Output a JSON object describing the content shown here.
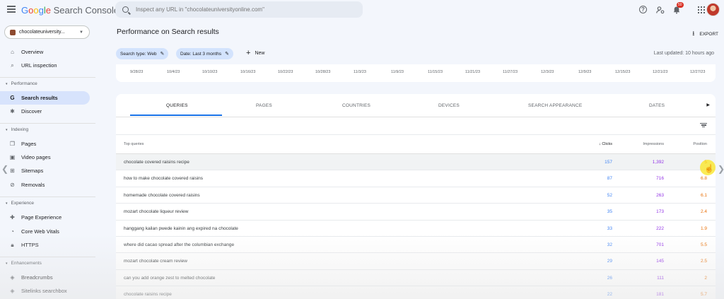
{
  "header": {
    "logo_google": "Google",
    "logo_product": "Search Console",
    "search_placeholder": "Inspect any URL in \"chocolateuniversityonline.com\"",
    "notification_count": "50"
  },
  "sidebar": {
    "property": "chocolateuniversity...",
    "items": [
      {
        "label": "Overview",
        "icon": "home-icon"
      },
      {
        "label": "URL inspection",
        "icon": "search-icon"
      }
    ],
    "sections": [
      {
        "title": "Performance",
        "items": [
          {
            "label": "Search results",
            "icon": "google-g-icon"
          },
          {
            "label": "Discover",
            "icon": "discover-icon"
          }
        ]
      },
      {
        "title": "Indexing",
        "items": [
          {
            "label": "Pages",
            "icon": "pages-icon"
          },
          {
            "label": "Video pages",
            "icon": "video-icon"
          },
          {
            "label": "Sitemaps",
            "icon": "sitemaps-icon"
          },
          {
            "label": "Removals",
            "icon": "removals-icon"
          }
        ]
      },
      {
        "title": "Experience",
        "items": [
          {
            "label": "Page Experience",
            "icon": "experience-icon"
          },
          {
            "label": "Core Web Vitals",
            "icon": "vitals-icon"
          },
          {
            "label": "HTTPS",
            "icon": "lock-icon"
          }
        ]
      },
      {
        "title": "Enhancements",
        "items": [
          {
            "label": "Breadcrumbs",
            "icon": "layers-icon"
          },
          {
            "label": "Sitelinks searchbox",
            "icon": "layers-icon"
          }
        ]
      }
    ]
  },
  "main": {
    "title": "Performance on Search results",
    "export_label": "EXPORT",
    "filters": [
      {
        "label": "Search type: Web"
      },
      {
        "label": "Date: Last 3 months"
      }
    ],
    "new_label": "New",
    "last_updated": "Last updated: 10 hours ago",
    "chart_dates": [
      "9/28/23",
      "10/4/23",
      "10/10/23",
      "10/16/23",
      "10/22/23",
      "10/28/23",
      "11/3/23",
      "11/9/23",
      "11/15/23",
      "11/21/23",
      "11/27/23",
      "12/3/23",
      "12/9/23",
      "12/15/23",
      "12/21/23",
      "12/27/23"
    ],
    "tabs": [
      "QUERIES",
      "PAGES",
      "COUNTRIES",
      "DEVICES",
      "SEARCH APPEARANCE",
      "DATES"
    ],
    "table": {
      "headers": {
        "query": "Top queries",
        "clicks": "Clicks",
        "impressions": "Impressions",
        "position": "Position"
      },
      "rows": [
        {
          "query": "chocolate covered raisins recipe",
          "clicks": "157",
          "impressions": "1,392",
          "position": "5"
        },
        {
          "query": "how to make chocolate covered raisins",
          "clicks": "87",
          "impressions": "716",
          "position": "6.8"
        },
        {
          "query": "homemade chocolate covered raisins",
          "clicks": "52",
          "impressions": "263",
          "position": "6.1"
        },
        {
          "query": "mozart chocolate liqueur review",
          "clicks": "35",
          "impressions": "173",
          "position": "2.4"
        },
        {
          "query": "hanggang kailan pwede kainin ang expired na chocolate",
          "clicks": "33",
          "impressions": "222",
          "position": "1.9"
        },
        {
          "query": "where did cacao spread after the columbian exchange",
          "clicks": "32",
          "impressions": "701",
          "position": "5.5"
        },
        {
          "query": "mozart chocolate cream review",
          "clicks": "29",
          "impressions": "145",
          "position": "2.5"
        },
        {
          "query": "can you add orange zest to melted chocolate",
          "clicks": "26",
          "impressions": "111",
          "position": "2"
        },
        {
          "query": "chocolate raisins recipe",
          "clicks": "22",
          "impressions": "181",
          "position": "5.7"
        }
      ]
    }
  },
  "colors": {
    "clicks": "#4285f4",
    "impressions": "#9334e6",
    "position": "#e8710a",
    "active_nav": "#d7e3fc",
    "chip": "#d3e3fd"
  }
}
